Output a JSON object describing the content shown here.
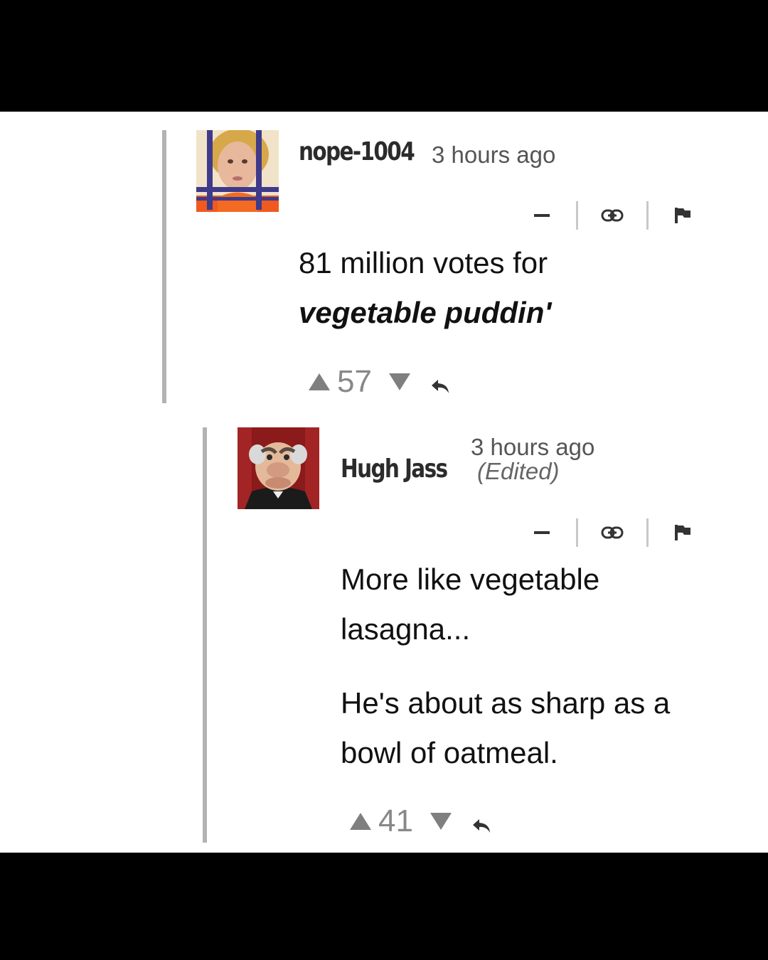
{
  "comments": [
    {
      "username": "nope-1004",
      "time": "3 hours ago",
      "body_line1": "81 million votes for",
      "body_line2": "vegetable puddin'",
      "votes": "57",
      "avatar_icon": "user-avatar-icon"
    },
    {
      "username": "Hugh Jass",
      "time": "3 hours ago",
      "edited": "(Edited)",
      "body_p1": "More like vegetable lasagna...",
      "body_p2": "He's about as sharp as a bowl of oatmeal.",
      "votes": "41",
      "avatar_icon": "user-avatar-icon"
    }
  ],
  "icons": {
    "collapse": "minus-icon",
    "permalink": "link-icon",
    "flag": "flag-icon",
    "upvote": "triangle-up-icon",
    "downvote": "triangle-down-icon",
    "reply": "reply-arrow-icon"
  },
  "colors": {
    "thread_line": "#b3b3b3",
    "meta_text": "#555555",
    "vote_gray": "#888888",
    "avatar1_shirt": "#f05a1e",
    "avatar1_bars": "#3f3a8a",
    "avatar2_bg": "#8b1a1a"
  }
}
